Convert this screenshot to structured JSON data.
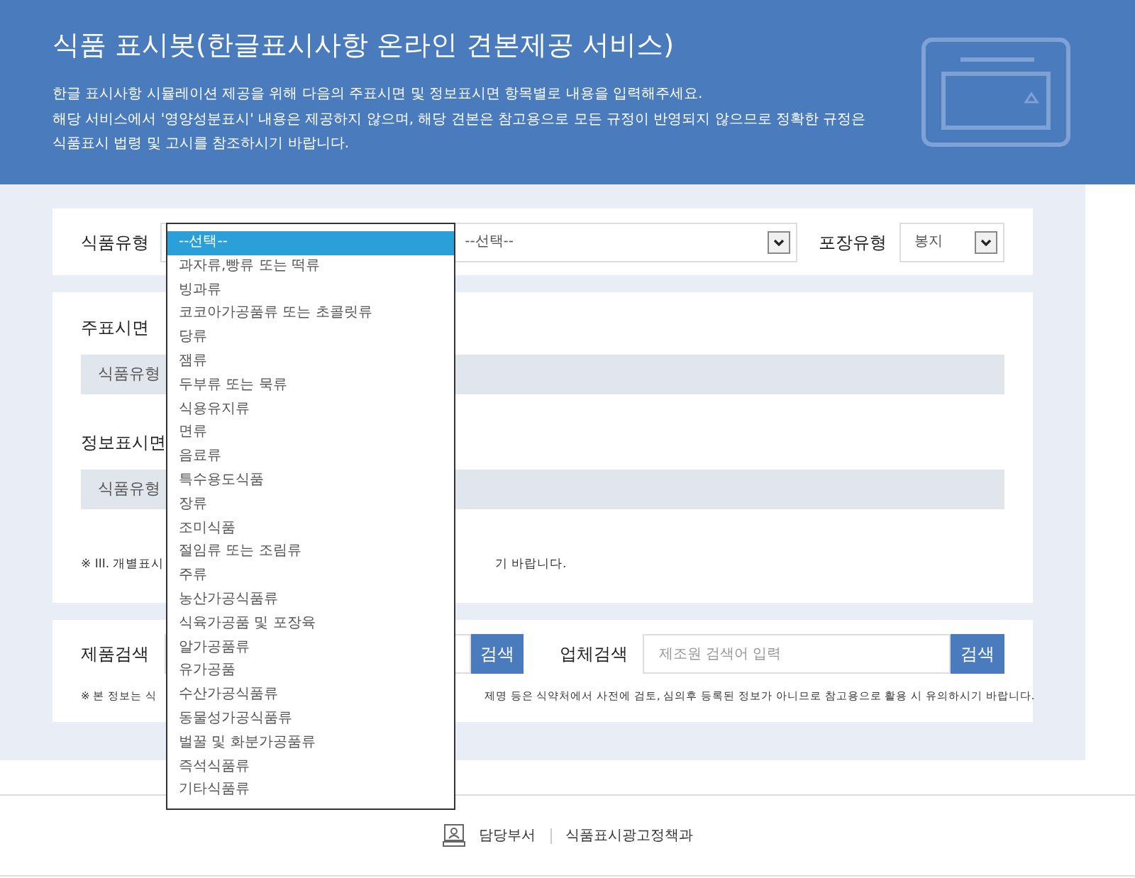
{
  "header": {
    "title": "식품 표시봇(한글표시사항 온라인 견본제공 서비스)",
    "description": [
      "한글 표시사항 시뮬레이션 제공을 위해 다음의 주표시면 및 정보표시면 항목별로 내용을 입력해주세요.",
      "해당 서비스에서 '영양성분표시' 내용은 제공하지 않으며, 해당 견본은 참고용으로 모든 규정이 반영되지 않으므로 정확한 규정은",
      "식품표시 법령 및 고시를 참조하시기 바랍니다."
    ]
  },
  "filter": {
    "food_type_label": "식품유형",
    "subtype_select": {
      "value": "--선택--"
    },
    "packaging_label": "포장유형",
    "packaging_select": {
      "value": "봉지"
    }
  },
  "dropdown": {
    "options": [
      {
        "label": "--선택--",
        "selected": true
      },
      {
        "label": "과자류,빵류 또는 떡류",
        "selected": false
      },
      {
        "label": "빙과류",
        "selected": false
      },
      {
        "label": "코코아가공품류 또는 초콜릿류",
        "selected": false
      },
      {
        "label": "당류",
        "selected": false
      },
      {
        "label": "잼류",
        "selected": false
      },
      {
        "label": "두부류 또는 묵류",
        "selected": false
      },
      {
        "label": "식용유지류",
        "selected": false
      },
      {
        "label": "면류",
        "selected": false
      },
      {
        "label": "음료류",
        "selected": false
      },
      {
        "label": "특수용도식품",
        "selected": false
      },
      {
        "label": "장류",
        "selected": false
      },
      {
        "label": "조미식품",
        "selected": false
      },
      {
        "label": "절임류 또는 조림류",
        "selected": false
      },
      {
        "label": "주류",
        "selected": false
      },
      {
        "label": "농산가공식품류",
        "selected": false
      },
      {
        "label": "식육가공품 및 포장육",
        "selected": false
      },
      {
        "label": "알가공품류",
        "selected": false
      },
      {
        "label": "유가공품",
        "selected": false
      },
      {
        "label": "수산가공식품류",
        "selected": false
      },
      {
        "label": "동물성가공식품류",
        "selected": false
      },
      {
        "label": "벌꿀 및 화분가공품류",
        "selected": false
      },
      {
        "label": "즉석식품류",
        "selected": false
      },
      {
        "label": "기타식품류",
        "selected": false
      }
    ]
  },
  "panels": [
    {
      "label": "주표시면",
      "bar_text": "식품유형"
    },
    {
      "label": "정보표시면",
      "bar_text": "식품유형"
    }
  ],
  "panel_note": {
    "left": "※ III. 개별표시",
    "right": "기 바랍니다."
  },
  "search": {
    "product": {
      "label": "제품검색",
      "button": "검색"
    },
    "company": {
      "label": "업체검색",
      "placeholder": "제조원 검색어 입력",
      "button": "검색"
    },
    "note": {
      "left": "※ 본 정보는 식",
      "right": "제명 등은 식약처에서 사전에 검토, 심의후 등록된 정보가 아니므로 참고용으로 활용 시 유의하시기 바랍니다."
    }
  },
  "footer": {
    "label": "담당부서",
    "value": "식품표시광고정책과"
  }
}
